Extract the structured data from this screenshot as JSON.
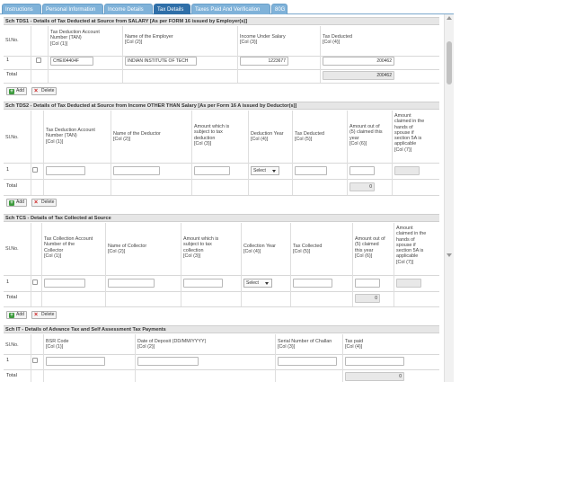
{
  "tabs": [
    {
      "label": "Instructions",
      "active": false
    },
    {
      "label": "Personal Information",
      "active": false
    },
    {
      "label": "Income Details",
      "active": false
    },
    {
      "label": "Tax Details",
      "active": true
    },
    {
      "label": "Taxes Paid And Verification",
      "active": false
    },
    {
      "label": "80G",
      "active": false
    }
  ],
  "tds1": {
    "title": "Sch TDS1 - Details of Tax Deducted at Source from SALARY [As per FORM 16 issued by Employer(s)]",
    "headers": {
      "slno": "Sl.No.",
      "tan": [
        "Tax Deduction Account",
        "Number (TAN)",
        "[Col (1)]"
      ],
      "employer": [
        "Name of the Employer",
        "[Col (2)]"
      ],
      "income": [
        "Income Under Salary",
        "[Col (3)]"
      ],
      "tax": [
        "Tax Deducted",
        "[Col (4)]"
      ]
    },
    "row": {
      "no": "1",
      "tan": "CHEI04404F",
      "employer": "INDIAN INSTITUTE OF TECH",
      "income": "1223677",
      "tax": "200462"
    },
    "total_label": "Total",
    "total_value": "200462",
    "add_label": "Add",
    "delete_label": "Delete"
  },
  "tds2": {
    "title": "Sch TDS2 - Details of Tax Deducted at Source from Income OTHER THAN Salary [As per Form 16 A issued by Deductor(s)]",
    "headers": {
      "slno": "Sl.No.",
      "tan": [
        "Tax Deduction Account",
        "Number (TAN)",
        "[Col (1)]"
      ],
      "deductor": [
        "Name of the Deductor",
        "[Col (2)]"
      ],
      "amount": [
        "Amount which is",
        "subject to tax",
        "deduction",
        "[Col (3)]"
      ],
      "year": [
        "Deduction Year",
        "[Col (4)]"
      ],
      "deducted": [
        "Tax Deducted",
        "[Col (5)]"
      ],
      "claimed": [
        "Amount out of",
        "(5) claimed this",
        "year",
        "[Col (6)]"
      ],
      "spouse": [
        "Amount",
        "claimed in the",
        "hands of",
        "spouse if",
        "section 5A is",
        "applicable",
        "[Col (7)]"
      ]
    },
    "row": {
      "no": "1",
      "select": "Select"
    },
    "total_label": "Total",
    "total_value": "0",
    "add_label": "Add",
    "delete_label": "Delete"
  },
  "tcs": {
    "title": "Sch TCS - Details of Tax Collected at Source",
    "headers": {
      "slno": "Sl.No.",
      "tan": [
        "Tax Collection Account",
        "Number of the",
        "Collector",
        "[Col (1)]"
      ],
      "collector": [
        "Name of Collector",
        "[Col (2)]"
      ],
      "amount": [
        "Amount which is",
        "subject to tax",
        "collection",
        "[Col (3)]"
      ],
      "year": [
        "Collection Year",
        "[Col (4)]"
      ],
      "collected": [
        "Tax Collected",
        "[Col (5)]"
      ],
      "claimed": [
        "Amount out of",
        "(5) claimed",
        "this year",
        "[Col (6)]"
      ],
      "spouse": [
        "Amount",
        "claimed in the",
        "hands of",
        "spouse if",
        "section 5A is",
        "applicable",
        "[Col (7)]"
      ]
    },
    "row": {
      "no": "1",
      "select": "Select"
    },
    "total_label": "Total",
    "total_value": "0",
    "add_label": "Add",
    "delete_label": "Delete"
  },
  "it": {
    "title": "Sch IT - Details of Advance Tax and Self Assessment Tax Payments",
    "headers": {
      "slno": "Sl.No.",
      "bsr": [
        "BSR Code",
        "[Col (1)]"
      ],
      "date": [
        "Date of Deposit (DD/MM/YYYY)",
        "[Col (2)]"
      ],
      "challan": [
        "Serial Number of Challan",
        "[Col (3)]"
      ],
      "paid": [
        "Tax paid",
        "[Col (4)]"
      ]
    },
    "row": {
      "no": "1"
    },
    "total_label": "Total",
    "total_value": "0"
  }
}
